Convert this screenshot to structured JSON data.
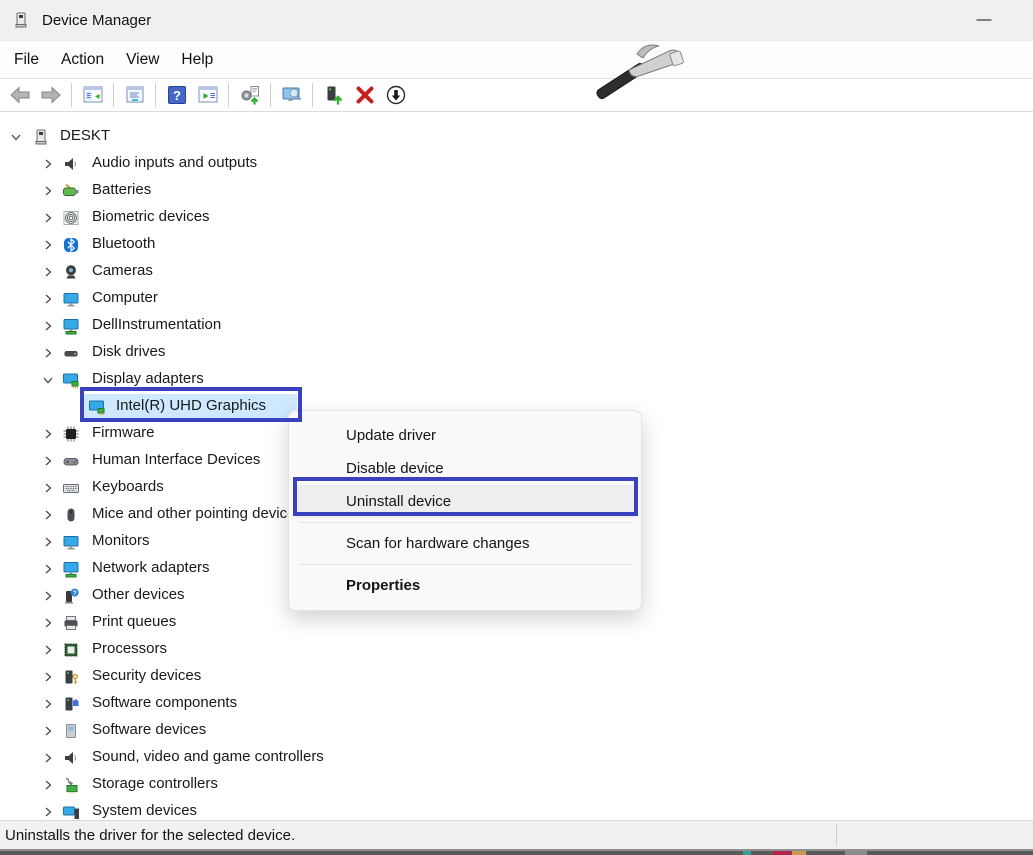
{
  "window": {
    "title": "Device Manager",
    "minimize_glyph": "—"
  },
  "menubar": {
    "items": [
      "File",
      "Action",
      "View",
      "Help"
    ]
  },
  "toolbar": {
    "buttons": [
      {
        "name": "back",
        "icon": "tb_back"
      },
      {
        "name": "forward",
        "icon": "tb_forward"
      },
      {
        "type": "separator"
      },
      {
        "name": "show-hide-console-tree",
        "icon": "tb_tree"
      },
      {
        "type": "separator"
      },
      {
        "name": "properties",
        "icon": "tb_props"
      },
      {
        "type": "separator"
      },
      {
        "name": "help",
        "icon": "tb_help"
      },
      {
        "name": "action-pane",
        "icon": "tb_action"
      },
      {
        "type": "separator"
      },
      {
        "name": "update-driver",
        "icon": "tb_update"
      },
      {
        "type": "separator"
      },
      {
        "name": "scan-hardware-changes",
        "icon": "tb_scan"
      },
      {
        "type": "separator"
      },
      {
        "name": "update-device-driver",
        "icon": "tb_devup"
      },
      {
        "name": "uninstall-device",
        "icon": "tb_uninstall"
      },
      {
        "name": "disable-device",
        "icon": "tb_disable"
      }
    ]
  },
  "tree": {
    "items": [
      {
        "label": "DESKT",
        "icon": "computer",
        "level": 0,
        "chevron": "down"
      },
      {
        "label": "Audio inputs and outputs",
        "icon": "speaker",
        "level": 1,
        "chevron": "right"
      },
      {
        "label": "Batteries",
        "icon": "battery",
        "level": 1,
        "chevron": "right"
      },
      {
        "label": "Biometric devices",
        "icon": "fingerprint",
        "level": 1,
        "chevron": "right"
      },
      {
        "label": "Bluetooth",
        "icon": "bluetooth",
        "level": 1,
        "chevron": "right"
      },
      {
        "label": "Cameras",
        "icon": "camera",
        "level": 1,
        "chevron": "right"
      },
      {
        "label": "Computer",
        "icon": "monitor",
        "level": 1,
        "chevron": "right"
      },
      {
        "label": "DellInstrumentation",
        "icon": "networkpc",
        "level": 1,
        "chevron": "right"
      },
      {
        "label": "Disk drives",
        "icon": "disk",
        "level": 1,
        "chevron": "right"
      },
      {
        "label": "Display adapters",
        "icon": "displayadapter",
        "level": 1,
        "chevron": "down"
      },
      {
        "label": "Intel(R) UHD Graphics",
        "icon": "gpu",
        "level": 2,
        "chevron": null,
        "selected": true
      },
      {
        "label": "Firmware",
        "icon": "chip",
        "level": 1,
        "chevron": "right"
      },
      {
        "label": "Human Interface Devices",
        "icon": "hid",
        "level": 1,
        "chevron": "right"
      },
      {
        "label": "Keyboards",
        "icon": "keyboard",
        "level": 1,
        "chevron": "right"
      },
      {
        "label": "Mice and other pointing devices",
        "icon": "mouse",
        "level": 1,
        "chevron": "right"
      },
      {
        "label": "Monitors",
        "icon": "monitor",
        "level": 1,
        "chevron": "right"
      },
      {
        "label": "Network adapters",
        "icon": "networkpc",
        "level": 1,
        "chevron": "right"
      },
      {
        "label": "Other devices",
        "icon": "unknown",
        "level": 1,
        "chevron": "right"
      },
      {
        "label": "Print queues",
        "icon": "printer",
        "level": 1,
        "chevron": "right"
      },
      {
        "label": "Processors",
        "icon": "processor",
        "level": 1,
        "chevron": "right"
      },
      {
        "label": "Security devices",
        "icon": "security",
        "level": 1,
        "chevron": "right"
      },
      {
        "label": "Software components",
        "icon": "softcomponent",
        "level": 1,
        "chevron": "right"
      },
      {
        "label": "Software devices",
        "icon": "softdevice",
        "level": 1,
        "chevron": "right"
      },
      {
        "label": "Sound, video and game controllers",
        "icon": "speaker",
        "level": 1,
        "chevron": "right"
      },
      {
        "label": "Storage controllers",
        "icon": "storage",
        "level": 1,
        "chevron": "right"
      },
      {
        "label": "System devices",
        "icon": "systemdev",
        "level": 1,
        "chevron": "right"
      }
    ]
  },
  "context_menu": {
    "items": [
      {
        "label": "Update driver"
      },
      {
        "label": "Disable device"
      },
      {
        "label": "Uninstall device",
        "hover": true,
        "annotated": true
      },
      {
        "type": "separator"
      },
      {
        "label": "Scan for hardware changes"
      },
      {
        "type": "separator"
      },
      {
        "label": "Properties",
        "bold": true
      }
    ]
  },
  "status_bar": {
    "left_text": "Uninstalls the driver for the selected device."
  },
  "colors": {
    "annotation_blue": "#3a41c1",
    "selection_highlight": "#cde8ff",
    "titlebar_bg": "#f0f0f0",
    "menu_bg": "#f9f9f9",
    "menu_hover": "#eeeeee",
    "status_bg": "#f1f1f1",
    "uninstall_x_red": "#c3201f",
    "help_blue": "#4667c6"
  }
}
